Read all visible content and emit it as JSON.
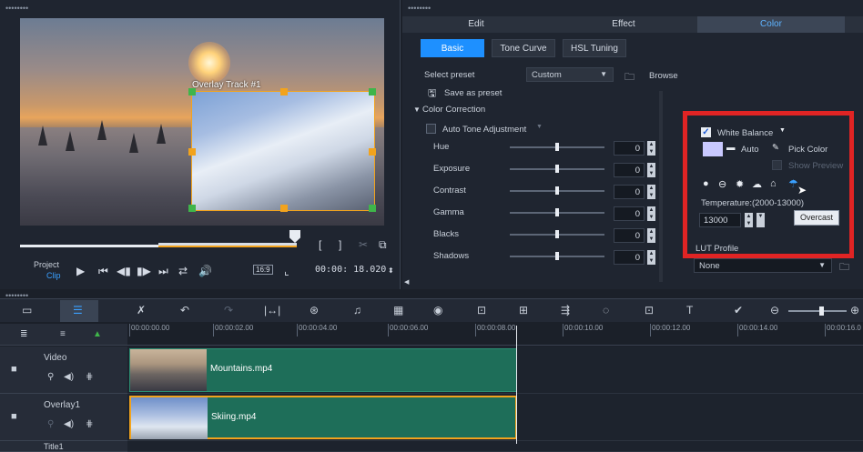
{
  "preview": {
    "overlay_label": "Overlay Track #1",
    "project_label": "Project",
    "clip_label": "Clip",
    "timecode": "00:00: 18.020",
    "aspect": "16:9"
  },
  "tabs": [
    {
      "label": "Edit"
    },
    {
      "label": "Effect"
    },
    {
      "label": "Color"
    }
  ],
  "subtabs": [
    "Basic",
    "Tone Curve",
    "HSL Tuning"
  ],
  "preset": {
    "label": "Select preset",
    "value": "Custom",
    "browse": "Browse",
    "save_as": "Save as preset"
  },
  "color_correction": {
    "header": "Color Correction",
    "auto_tone": "Auto Tone Adjustment",
    "sliders": [
      {
        "label": "Hue",
        "value": "0"
      },
      {
        "label": "Exposure",
        "value": "0"
      },
      {
        "label": "Contrast",
        "value": "0"
      },
      {
        "label": "Gamma",
        "value": "0"
      },
      {
        "label": "Blacks",
        "value": "0"
      },
      {
        "label": "Shadows",
        "value": "0"
      }
    ]
  },
  "white_balance": {
    "title": "White Balance",
    "auto": "Auto",
    "pick_color": "Pick Color",
    "show_preview": "Show Preview",
    "temperature_label": "Temperature:(2000-13000)",
    "temperature_value": "13000",
    "tooltip": "Overcast"
  },
  "lut": {
    "label": "LUT Profile",
    "value": "None"
  },
  "timeline": {
    "ticks": [
      "00:00:00.00",
      "00:00:02.00",
      "00:00:04.00",
      "00:00:06.00",
      "00:00:08.00",
      "00:00:10.00",
      "00:00:12.00",
      "00:00:14.00",
      "00:00:16.0"
    ],
    "tracks": [
      {
        "name": "Video",
        "clip": "Mountains.mp4"
      },
      {
        "name": "Overlay1",
        "clip": "Skiing.mp4"
      },
      {
        "name": "Title1"
      }
    ]
  },
  "colors": {
    "accent": "#1e90ff",
    "highlight": "#e02424",
    "handle": "#f2a31d",
    "clip": "#1e6e59"
  }
}
